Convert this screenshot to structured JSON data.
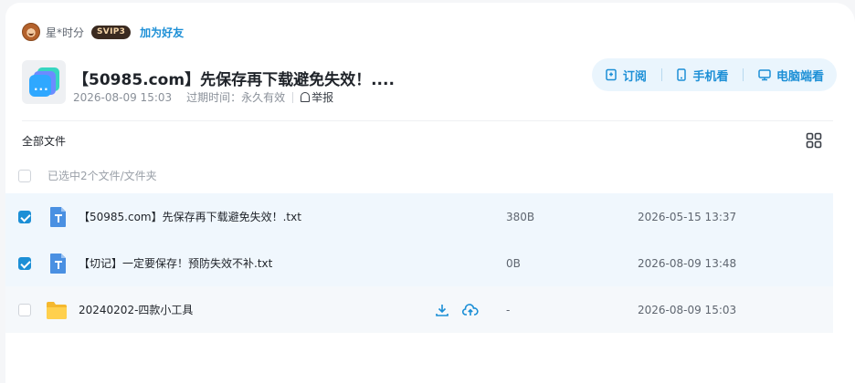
{
  "sharer": {
    "name": "星*时分",
    "badge": "SVIP3",
    "add_friend": "加为好友"
  },
  "share": {
    "title": "【50985.com】先保存再下载避免失效！....",
    "date": "2026-08-09 15:03",
    "expire_label": "过期时间：",
    "expire_value": "永久有效",
    "report": "举报"
  },
  "actions": {
    "subscribe": "订阅",
    "phone": "手机看",
    "pc": "电脑端看"
  },
  "breadcrumb": "全部文件",
  "selection_text": "已选中2个文件/文件夹",
  "files": [
    {
      "name": "【50985.com】先保存再下载避免失效！.txt",
      "size": "380B",
      "date": "2026-05-15 13:37",
      "checked": true,
      "type": "txt-icon"
    },
    {
      "name": "【切记】一定要保存！预防失效不补.txt",
      "size": "0B",
      "date": "2026-08-09 13:48",
      "checked": true,
      "type": "txt-icon"
    },
    {
      "name": "20240202-四款小工具",
      "size": "-",
      "date": "2026-08-09 15:03",
      "checked": false,
      "type": "folder-icon"
    }
  ],
  "colors": {
    "accent": "#1c8fd6",
    "selected_row": "#f0f7fd",
    "action_bar": "#eaf5fd"
  }
}
